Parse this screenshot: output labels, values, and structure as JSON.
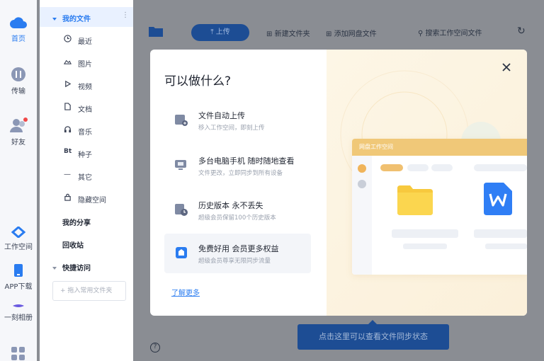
{
  "rail": {
    "items": [
      {
        "label": "首页",
        "icon": "cloud-icon",
        "active": true
      },
      {
        "label": "传输",
        "icon": "transfer-icon"
      },
      {
        "label": "好友",
        "icon": "friends-icon"
      },
      {
        "label": "工作空间",
        "icon": "workspace-icon"
      },
      {
        "label": "APP下载",
        "icon": "phone-icon"
      },
      {
        "label": "一刻相册",
        "icon": "album-icon"
      }
    ]
  },
  "nav": {
    "my_files": "我的文件",
    "sub_items": [
      {
        "label": "最近",
        "icon": "clock-icon"
      },
      {
        "label": "图片",
        "icon": "image-icon"
      },
      {
        "label": "视频",
        "icon": "play-icon"
      },
      {
        "label": "文档",
        "icon": "document-icon"
      },
      {
        "label": "音乐",
        "icon": "headphones-icon"
      },
      {
        "label": "种子",
        "icon": "bt-icon"
      },
      {
        "label": "其它",
        "icon": "dash-icon"
      },
      {
        "label": "隐藏空间",
        "icon": "lock-icon"
      }
    ],
    "my_share": "我的分享",
    "recycle_bin": "回收站",
    "quick_access": "快捷访问",
    "add_folder": "+ 拖入常用文件夹"
  },
  "toolbar": {
    "upload": "上传",
    "new_folder": "新建文件夹",
    "add_cloud_file": "添加网盘文件",
    "search_placeholder": "搜索工作空间文件"
  },
  "tooltip": "点击这里可以查看文件同步状态",
  "modal": {
    "title": "可以做什么?",
    "features": [
      {
        "title": "文件自动上传",
        "subtitle": "移入工作空间，即刻上传",
        "icon": "auto-upload-icon"
      },
      {
        "title": "多台电脑手机 随时随地查看",
        "subtitle": "文件更改，立即同步到所有设备",
        "icon": "multi-device-icon"
      },
      {
        "title": "历史版本 永不丢失",
        "subtitle": "超级会员保留100个历史版本",
        "icon": "history-icon"
      },
      {
        "title": "免费好用 会员更多权益",
        "subtitle": "超级会员尊享无限同步流量",
        "icon": "member-icon",
        "active": true
      }
    ],
    "learn_more": "了解更多",
    "illustration_header": "网盘工作空间"
  },
  "colors": {
    "accent": "#2a7cf0",
    "dim_bg": "#8a8d93",
    "warm": "#f0c878",
    "folder": "#f7c93e",
    "word": "#2f7ef5"
  }
}
